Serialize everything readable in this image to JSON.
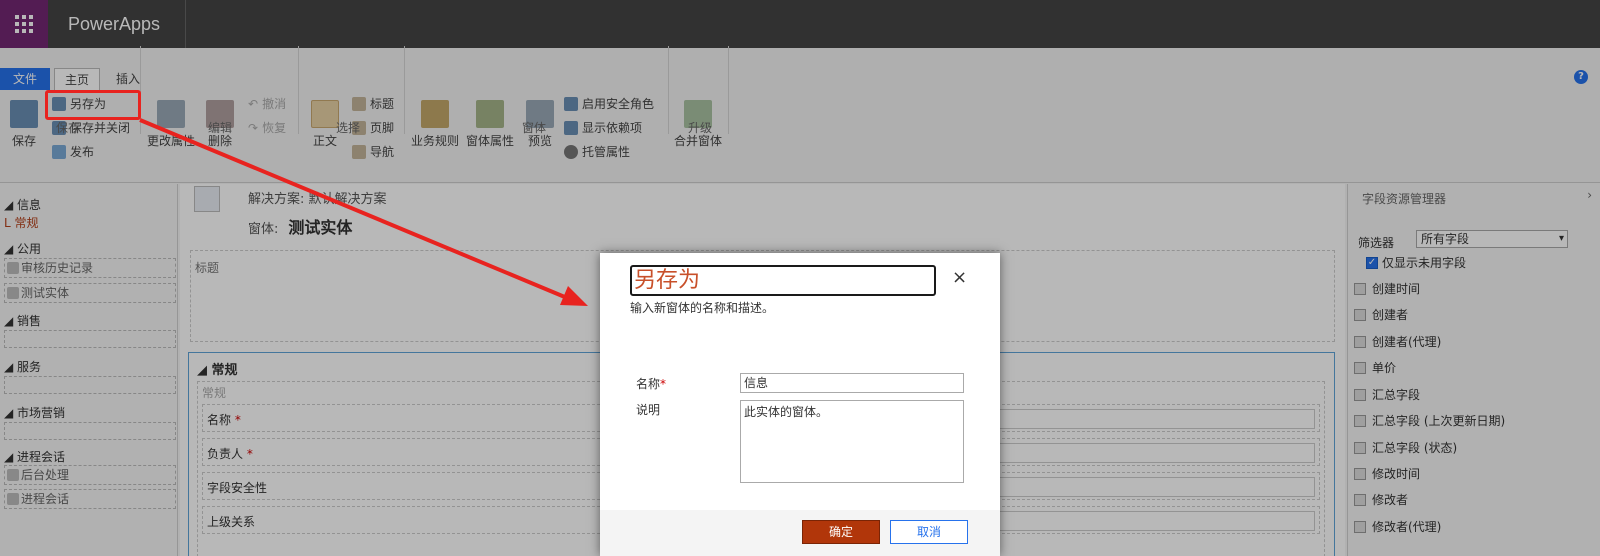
{
  "app": {
    "title": "PowerApps"
  },
  "ribbon": {
    "tabs": {
      "file": "文件",
      "home": "主页",
      "insert": "插入"
    },
    "help": "?",
    "save_group": {
      "save": "保存",
      "save_as": "另存为",
      "save_close": "保存并关闭",
      "publish": "发布",
      "label": "保存"
    },
    "edit_group": {
      "change_props": "更改属性",
      "delete": "删除",
      "undo": "撤消",
      "redo": "恢复",
      "label": "编辑"
    },
    "select_group": {
      "body": "正文",
      "header": "标题",
      "footer": "页脚",
      "nav": "导航",
      "label": "选择"
    },
    "form_group": {
      "business_rules": "业务规则",
      "form_props": "窗体属性",
      "preview": "预览",
      "enable_roles": "启用安全角色",
      "show_deps": "显示依赖项",
      "managed_props": "托管属性",
      "label": "窗体"
    },
    "upgrade_group": {
      "merge": "合并窗体",
      "label": "升级"
    }
  },
  "leftnav": {
    "info": "信息",
    "general": "常规",
    "common": "公用",
    "audit": "审核历史记录",
    "test_entity": "测试实体",
    "sales": "销售",
    "service": "服务",
    "marketing": "市场营销",
    "process": "进程会话",
    "background": "后台处理",
    "process_session": "进程会话"
  },
  "main": {
    "solution": "解决方案: 默认解决方案",
    "form_label": "窗体:",
    "form_name": "测试实体",
    "header_label": "标题",
    "tab_title": "常规",
    "section_label": "常规",
    "fields": [
      "名称",
      "负责人",
      "字段安全性",
      "上级关系"
    ]
  },
  "rightpanel": {
    "title": "字段资源管理器",
    "filter_label": "筛选器",
    "filter_value": "所有字段",
    "only_unused": "仅显示未用字段",
    "fields": [
      "创建时间",
      "创建者",
      "创建者(代理)",
      "单价",
      "汇总字段",
      "汇总字段 (上次更新日期)",
      "汇总字段 (状态)",
      "修改时间",
      "修改者",
      "修改者(代理)"
    ]
  },
  "dialog": {
    "title": "另存为",
    "close": "×",
    "description": "输入新窗体的名称和描述。",
    "name_label": "名称",
    "required": "*",
    "desc_label": "说明",
    "name_value": "信息",
    "desc_value": "此实体的窗体。",
    "ok": "确定",
    "cancel": "取消"
  },
  "colors": {
    "brand": "#742774",
    "accent": "#2672ec",
    "ok_button": "#b1360a",
    "annotation": "#e8231f"
  }
}
